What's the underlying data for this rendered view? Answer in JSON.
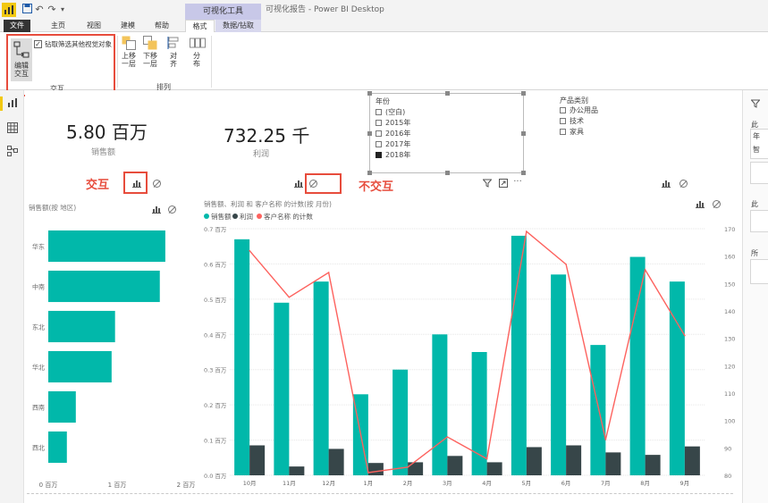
{
  "titlebar": {
    "undo": "↶",
    "redo": "↷",
    "context_group": "可视化工具",
    "title": "可视化报告 - Power BI Desktop"
  },
  "tabs": [
    "文件",
    "主页",
    "视图",
    "建模",
    "帮助",
    "格式",
    "数据/钻取"
  ],
  "ribbon": {
    "edit_interactions": [
      "编辑",
      "交互"
    ],
    "sync_slicers_checkbox": "钻取筛选其他视觉对象",
    "interaction_group": "交互",
    "arrange_group": "排列",
    "bring_forward": [
      "上移",
      "一层"
    ],
    "send_backward": [
      "下移",
      "一层"
    ],
    "align": [
      "对",
      "齐"
    ],
    "distribute": [
      "分",
      "布"
    ]
  },
  "cards": {
    "sales": {
      "value": "5.80 百万",
      "label": "销售额"
    },
    "profit": {
      "value": "732.25 千",
      "label": "利润"
    }
  },
  "year_slicer": {
    "title": "年份",
    "items": [
      {
        "label": "(空白)",
        "checked": false
      },
      {
        "label": "2015年",
        "checked": false
      },
      {
        "label": "2016年",
        "checked": false
      },
      {
        "label": "2017年",
        "checked": false
      },
      {
        "label": "2018年",
        "checked": true
      }
    ]
  },
  "category_slicer": {
    "title": "产品类别",
    "items": [
      "办公用品",
      "技术",
      "家具"
    ]
  },
  "annotations": {
    "interact": "交互",
    "no_interact": "不交互"
  },
  "bar_chart": {
    "title": "销售额(按 地区)",
    "chart_data": {
      "type": "bar",
      "orientation": "horizontal",
      "categories": [
        "华东",
        "中南",
        "东北",
        "华北",
        "西南",
        "西北"
      ],
      "values": [
        1.7,
        1.62,
        0.97,
        0.92,
        0.4,
        0.27
      ],
      "xlim": [
        0,
        2
      ],
      "xticks": [
        "0 百万",
        "1 百万",
        "2 百万"
      ],
      "bar_color": "#01b8aa"
    }
  },
  "combo_chart": {
    "title": "销售额、利润 和 客户名称 的计数(按 月份)",
    "legend": [
      "销售额",
      "利润",
      "客户名称 的计数"
    ],
    "chart_data": {
      "type": "bar",
      "categories": [
        "10月",
        "11月",
        "12月",
        "1月",
        "2月",
        "3月",
        "4月",
        "5月",
        "6月",
        "7月",
        "8月",
        "9月"
      ],
      "series": [
        {
          "name": "销售额",
          "values": [
            0.67,
            0.49,
            0.55,
            0.23,
            0.3,
            0.4,
            0.35,
            0.68,
            0.57,
            0.37,
            0.62,
            0.55
          ],
          "color": "#01b8aa",
          "axis": "left"
        },
        {
          "name": "利润",
          "values": [
            0.085,
            0.025,
            0.075,
            0.035,
            0.037,
            0.055,
            0.037,
            0.08,
            0.085,
            0.065,
            0.058,
            0.082
          ],
          "color": "#374649",
          "axis": "left"
        },
        {
          "name": "客户名称 的计数",
          "type": "line",
          "values": [
            162,
            145,
            154,
            81,
            83,
            94,
            86,
            169,
            157,
            93,
            155,
            131
          ],
          "color": "#fd625e",
          "axis": "right"
        }
      ],
      "ylim_left": [
        0,
        0.7
      ],
      "yticks_left": [
        "0.0 百万",
        "0.1 百万",
        "0.2 百万",
        "0.3 百万",
        "0.4 百万",
        "0.5 百万",
        "0.6 百万",
        "0.7 百万"
      ],
      "ylim_right": [
        80,
        170
      ],
      "yticks_right": [
        "80",
        "90",
        "100",
        "110",
        "120",
        "130",
        "140",
        "150",
        "160",
        "170"
      ],
      "grid": true
    }
  },
  "right_pane": {
    "filters_icon": "filter-icon",
    "labels": [
      "此",
      "年",
      "智",
      "此",
      "所"
    ]
  },
  "colors": {
    "accent": "#01b8aa",
    "dark": "#374649",
    "line": "#fd625e",
    "annotation": "#e74c3c",
    "pbi_yellow": "#f2c811"
  }
}
